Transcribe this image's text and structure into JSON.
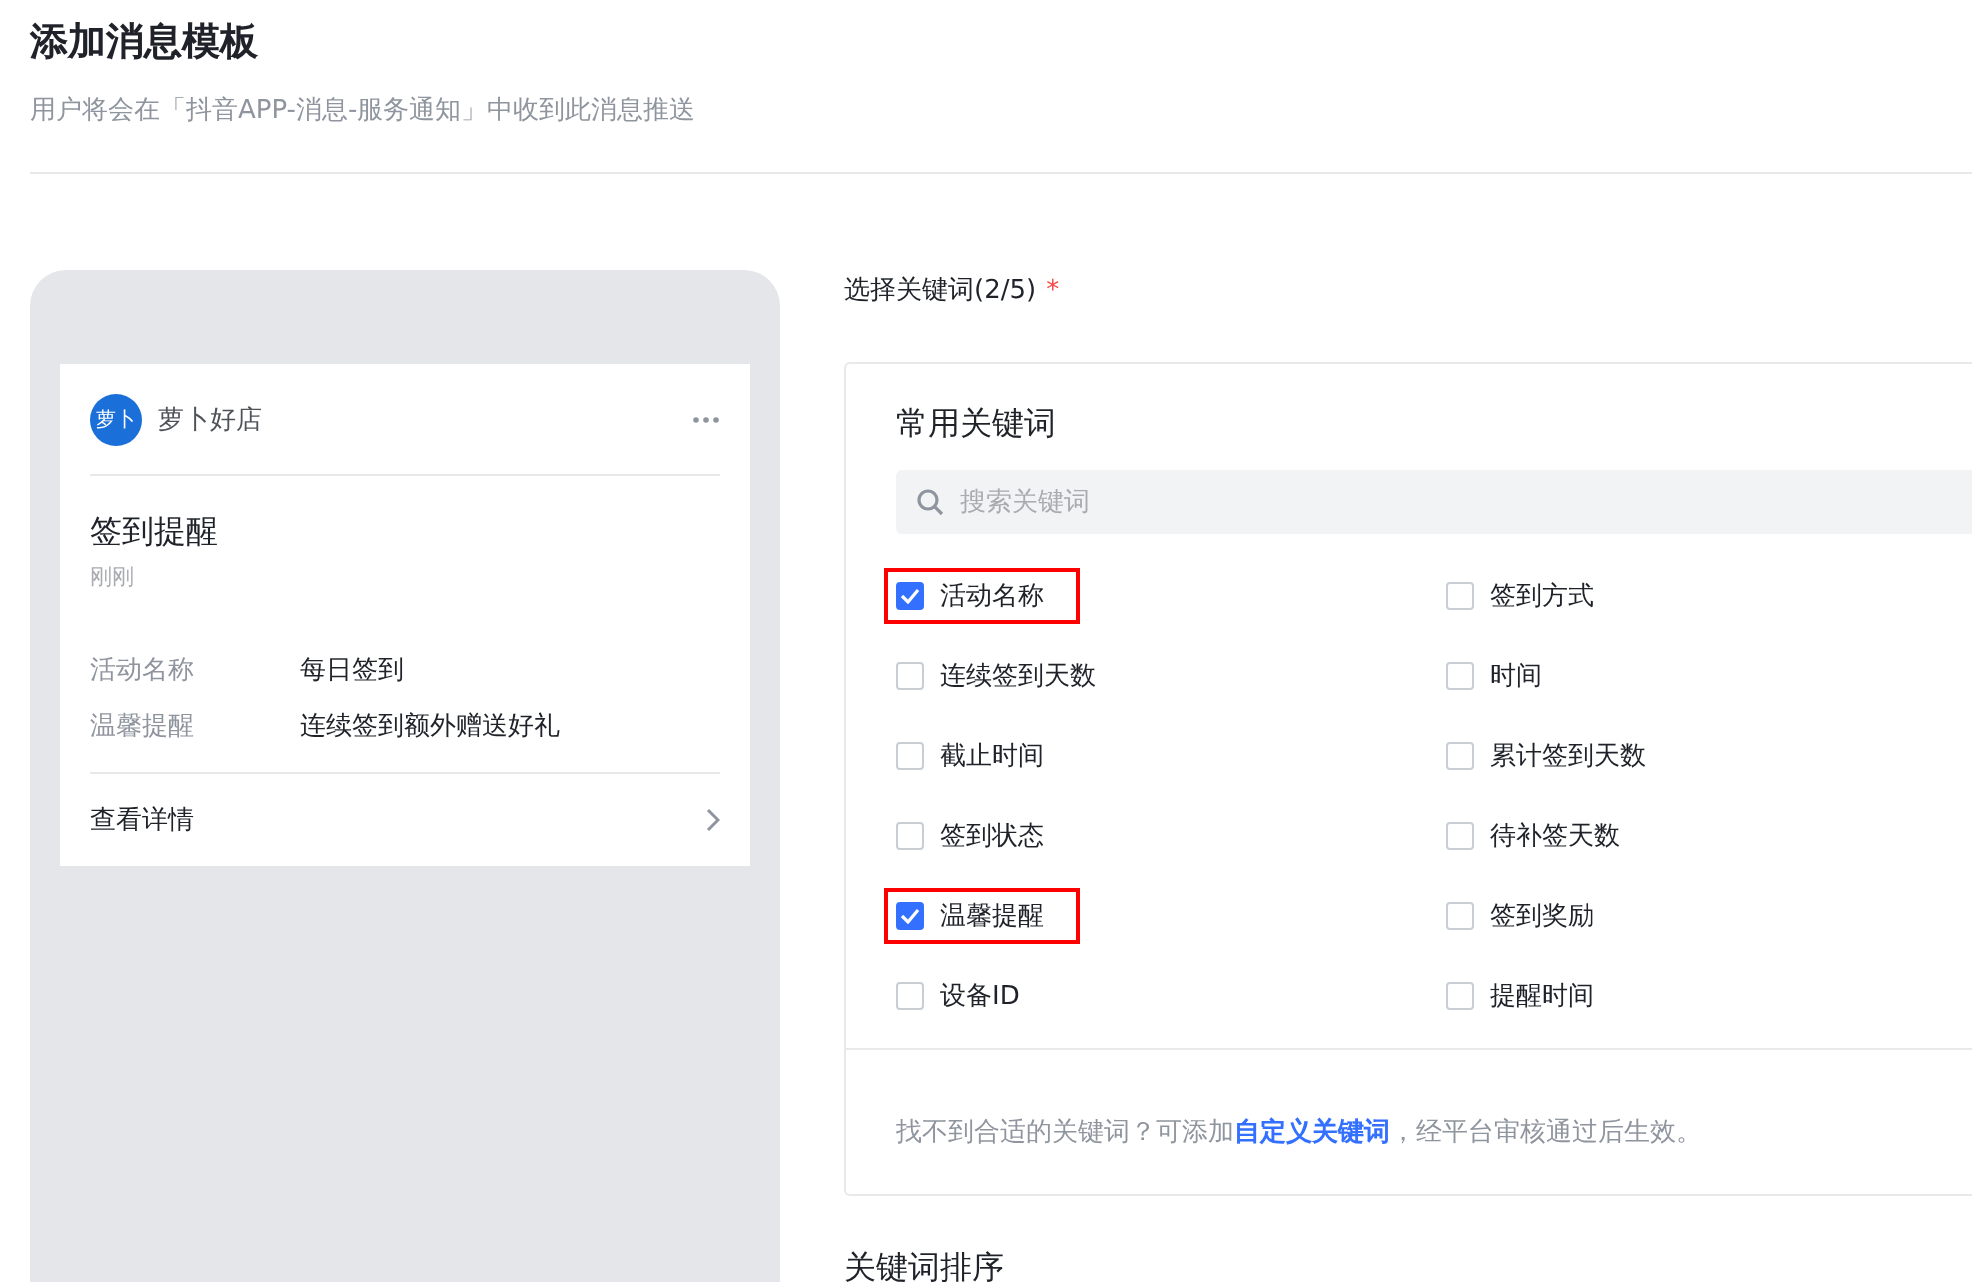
{
  "page": {
    "title": "添加消息模板",
    "subtitle": "用户将会在「抖音APP-消息-服务通知」中收到此消息推送"
  },
  "preview": {
    "shop": {
      "avatar_text": "萝卜",
      "name": "萝卜好店"
    },
    "message": {
      "title": "签到提醒",
      "time": "刚刚",
      "fields": [
        {
          "label": "活动名称",
          "value": "每日签到"
        },
        {
          "label": "温馨提醒",
          "value": "连续签到额外赠送好礼"
        }
      ],
      "link": "查看详情"
    }
  },
  "keywords": {
    "label": "选择关键词(2/5)",
    "required_mark": "*",
    "section_title": "常用关键词",
    "search": {
      "placeholder": "搜索关键词"
    },
    "items": [
      {
        "label": "活动名称",
        "checked": true,
        "highlighted": true
      },
      {
        "label": "签到方式",
        "checked": false,
        "highlighted": false
      },
      {
        "label": "连续签到天数",
        "checked": false,
        "highlighted": false
      },
      {
        "label": "时间",
        "checked": false,
        "highlighted": false
      },
      {
        "label": "截止时间",
        "checked": false,
        "highlighted": false
      },
      {
        "label": "累计签到天数",
        "checked": false,
        "highlighted": false
      },
      {
        "label": "签到状态",
        "checked": false,
        "highlighted": false
      },
      {
        "label": "待补签天数",
        "checked": false,
        "highlighted": false
      },
      {
        "label": "温馨提醒",
        "checked": true,
        "highlighted": true
      },
      {
        "label": "签到奖励",
        "checked": false,
        "highlighted": false
      },
      {
        "label": "设备ID",
        "checked": false,
        "highlighted": false
      },
      {
        "label": "提醒时间",
        "checked": false,
        "highlighted": false
      }
    ],
    "footer": {
      "before": "找不到合适的关键词？可添加",
      "link": "自定义关键词",
      "after": "，经平台审核通过后生效。"
    }
  },
  "sorting": {
    "title": "关键词排序"
  }
}
